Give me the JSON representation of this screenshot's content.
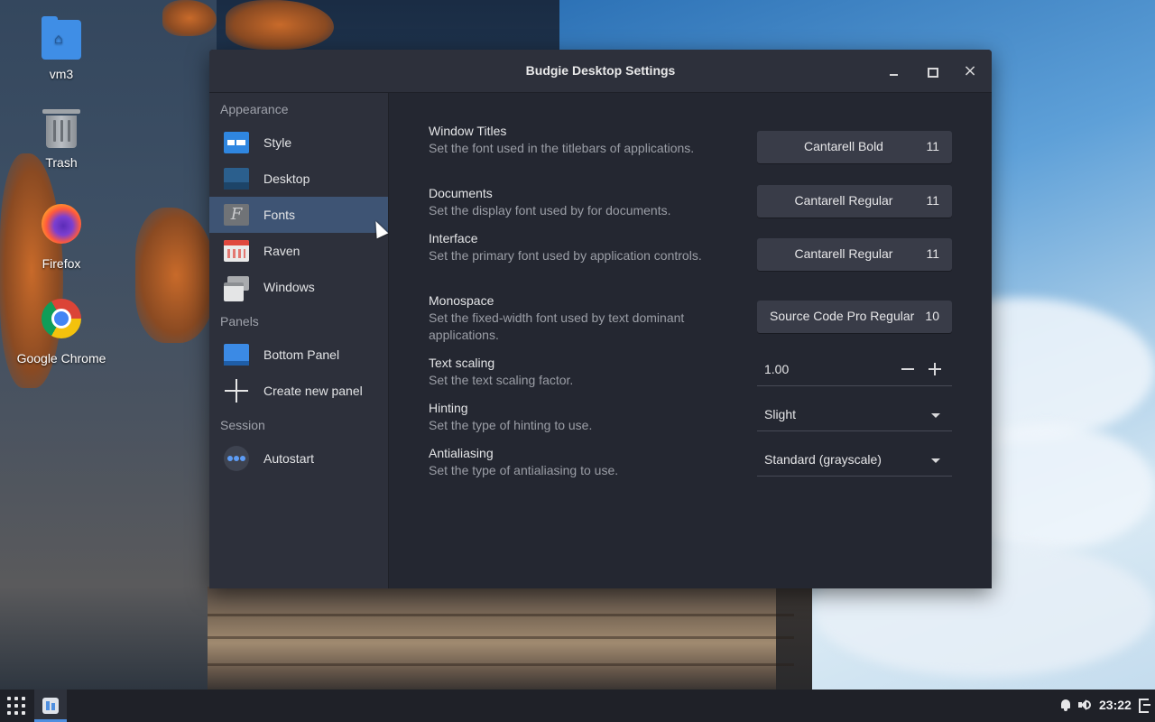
{
  "desktop": {
    "icons": [
      {
        "label": "vm3",
        "icon": "home-folder-icon"
      },
      {
        "label": "Trash",
        "icon": "trash-icon"
      },
      {
        "label": "Firefox",
        "icon": "firefox-icon"
      },
      {
        "label": "Google Chrome",
        "icon": "chrome-icon"
      }
    ]
  },
  "window": {
    "title": "Budgie Desktop Settings",
    "controls": {
      "minimize": "minimize-icon",
      "maximize": "maximize-icon",
      "close": "×"
    }
  },
  "sidebar": {
    "sections": [
      {
        "heading": "Appearance"
      },
      {
        "heading": "Panels"
      },
      {
        "heading": "Session"
      }
    ],
    "items": [
      {
        "label": "Style",
        "icon": "style-icon"
      },
      {
        "label": "Desktop",
        "icon": "desktop-icon"
      },
      {
        "label": "Fonts",
        "icon": "fonts-icon",
        "selected": true
      },
      {
        "label": "Raven",
        "icon": "raven-icon"
      },
      {
        "label": "Windows",
        "icon": "windows-icon"
      },
      {
        "label": "Bottom Panel",
        "icon": "panel-icon"
      },
      {
        "label": "Create new panel",
        "icon": "plus-icon"
      },
      {
        "label": "Autostart",
        "icon": "autostart-icon"
      }
    ]
  },
  "fonts": {
    "rows": [
      {
        "title": "Window Titles",
        "desc": "Set the font used in the titlebars of applications.",
        "font": "Cantarell Bold",
        "size": "11"
      },
      {
        "title": "Documents",
        "desc": "Set the display font used by for documents.",
        "font": "Cantarell Regular",
        "size": "11"
      },
      {
        "title": "Interface",
        "desc": "Set the primary font used by application controls.",
        "font": "Cantarell Regular",
        "size": "11"
      },
      {
        "title": "Monospace",
        "desc": "Set the fixed-width font used by text dominant applications.",
        "font": "Source Code Pro Regular",
        "size": "10"
      }
    ],
    "text_scaling": {
      "title": "Text scaling",
      "desc": "Set the text scaling factor.",
      "value": "1.00"
    },
    "hinting": {
      "title": "Hinting",
      "desc": "Set the type of hinting to use.",
      "value": "Slight"
    },
    "antialiasing": {
      "title": "Antialiasing",
      "desc": "Set the type of antialiasing to use.",
      "value": "Standard (grayscale)"
    }
  },
  "taskbar": {
    "clock": "23:22",
    "accent": "#4f8fe0"
  }
}
